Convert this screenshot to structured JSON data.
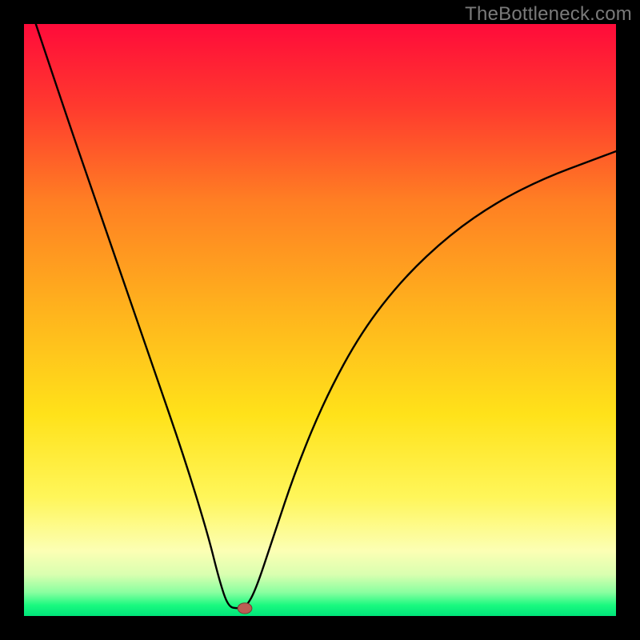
{
  "watermark": "TheBottleneck.com",
  "colors": {
    "frame": "#000000",
    "curve": "#000000",
    "marker_fill": "#bb5e54",
    "marker_stroke": "#7a3b34"
  },
  "chart_data": {
    "type": "line",
    "title": "",
    "xlabel": "",
    "ylabel": "",
    "xlim": [
      0,
      100
    ],
    "ylim": [
      0,
      100
    ],
    "grid": false,
    "legend": false,
    "annotations": [],
    "gradient_bands": [
      {
        "y_from": 100,
        "y_to": 80,
        "color_top": "#ff0b3a",
        "color_bottom": "#ff5a2b",
        "note": "red→orange"
      },
      {
        "y_from": 80,
        "y_to": 55,
        "color_top": "#ff5a2b",
        "color_bottom": "#ffb21d",
        "note": "orange"
      },
      {
        "y_from": 55,
        "y_to": 25,
        "color_top": "#ffb21d",
        "color_bottom": "#fff11a",
        "note": "yellow"
      },
      {
        "y_from": 25,
        "y_to": 10,
        "color_top": "#fff11a",
        "color_bottom": "#ffff9a",
        "note": "pale yellow"
      },
      {
        "y_from": 10,
        "y_to": 2,
        "color_top": "#fcffb4",
        "color_bottom": "#7aff8f",
        "note": "pale green"
      },
      {
        "y_from": 2,
        "y_to": 0,
        "color_top": "#19f97f",
        "color_bottom": "#00e57a",
        "note": "green"
      }
    ],
    "series": [
      {
        "name": "bottleneck-curve",
        "note": "V-shaped curve; left branch near-linear, right branch concave rising. Values estimated from pixel positions on a 0–100 scale.",
        "points": [
          {
            "x": 2,
            "y": 100
          },
          {
            "x": 7,
            "y": 85
          },
          {
            "x": 12,
            "y": 70.5
          },
          {
            "x": 17,
            "y": 56
          },
          {
            "x": 22,
            "y": 41.5
          },
          {
            "x": 27,
            "y": 27
          },
          {
            "x": 31,
            "y": 14
          },
          {
            "x": 33,
            "y": 6
          },
          {
            "x": 34.5,
            "y": 1.5
          },
          {
            "x": 36.2,
            "y": 1.3
          },
          {
            "x": 37.3,
            "y": 1.3
          },
          {
            "x": 39,
            "y": 4
          },
          {
            "x": 42,
            "y": 13
          },
          {
            "x": 46,
            "y": 25
          },
          {
            "x": 51,
            "y": 37
          },
          {
            "x": 57,
            "y": 48
          },
          {
            "x": 64,
            "y": 57
          },
          {
            "x": 72,
            "y": 64.5
          },
          {
            "x": 80,
            "y": 70
          },
          {
            "x": 88,
            "y": 74
          },
          {
            "x": 96,
            "y": 77
          },
          {
            "x": 100,
            "y": 78.5
          }
        ]
      }
    ],
    "marker": {
      "x": 37.3,
      "y": 1.3,
      "rx": 1.2,
      "ry": 0.9
    }
  }
}
